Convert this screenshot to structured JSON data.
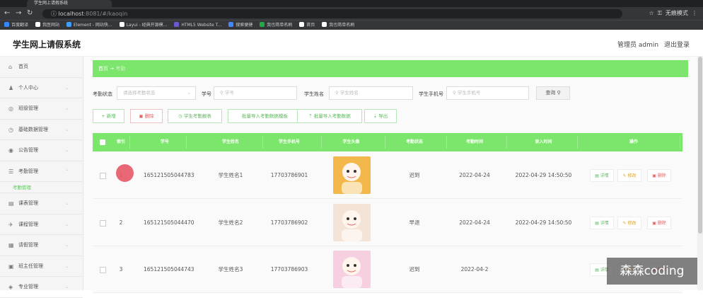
{
  "browser": {
    "tab_title": "学生网上请假系统",
    "url_host": "localhost",
    "url_rest": ":8081/#/kaoqin",
    "incognito_label": "无痕模式",
    "bookmarks": [
      {
        "label": "百度翻译",
        "color": "#3388ff"
      },
      {
        "label": "我医网站",
        "color": "#ffffff"
      },
      {
        "label": "Element - 网站快...",
        "color": "#409eff"
      },
      {
        "label": "Layui - 经典开源模...",
        "color": "#ffffff"
      },
      {
        "label": "HTML5 Website T...",
        "color": "#6a5acd"
      },
      {
        "label": "搜索便捷",
        "color": "#4488ff"
      },
      {
        "label": "我也简单名刷",
        "color": "#22aa44"
      },
      {
        "label": "首页",
        "color": "#ffffff"
      },
      {
        "label": "我也简单名刷",
        "color": "#ffffff"
      }
    ]
  },
  "header": {
    "title": "学生网上请假系统",
    "admin": "管理员 admin",
    "logout": "退出登录"
  },
  "sidebar": {
    "items": [
      {
        "label": "首页",
        "icon": "home-icon",
        "glyph": "⌂"
      },
      {
        "label": "个人中心",
        "icon": "user-icon",
        "glyph": "♟"
      },
      {
        "label": "班级管理",
        "icon": "class-icon",
        "glyph": "◎"
      },
      {
        "label": "基础数据管理",
        "icon": "data-icon",
        "glyph": "◷"
      },
      {
        "label": "公告管理",
        "icon": "notice-icon",
        "glyph": "◉"
      },
      {
        "label": "考勤管理",
        "icon": "attendance-icon",
        "glyph": "☰"
      },
      {
        "label": "课表管理",
        "icon": "schedule-icon",
        "glyph": "▤"
      },
      {
        "label": "课程管理",
        "icon": "course-icon",
        "glyph": "✈"
      },
      {
        "label": "请假管理",
        "icon": "leave-icon",
        "glyph": "▦"
      },
      {
        "label": "班主任管理",
        "icon": "teacher-icon",
        "glyph": "▣"
      },
      {
        "label": "专业管理",
        "icon": "major-icon",
        "glyph": "◈"
      }
    ],
    "sub_item": "考勤管理"
  },
  "breadcrumb": {
    "home": "首页",
    "arrow": "→",
    "current": "考勤"
  },
  "filters": {
    "status_label": "考勤状态",
    "status_placeholder": "请选择考勤状态",
    "student_no_label": "学号",
    "student_no_placeholder": "学号",
    "name_label": "学生姓名",
    "name_placeholder": "学生姓名",
    "phone_label": "学生手机号",
    "phone_placeholder": "学生手机号",
    "search_label": "查询"
  },
  "actions": {
    "add": "+ 新增",
    "delete": "删除",
    "report": "学生考勤报表",
    "import_template": "批量导入考勤数据模板",
    "import_data": "批量导入考勤数据",
    "export": "导出"
  },
  "table": {
    "headers": [
      "索引",
      "学号",
      "学生姓名",
      "学生手机号",
      "学生头像",
      "考勤状态",
      "考勤时间",
      "录入时间",
      "操作"
    ],
    "rows": [
      {
        "index": "1",
        "student_no": "165121505044783",
        "name": "学生姓名1",
        "phone": "17703786901",
        "status": "迟到",
        "date": "2022-04-24",
        "created": "2022-04-29 14:50:50",
        "avatar_color": "#f2b84b"
      },
      {
        "index": "2",
        "student_no": "165121505044470",
        "name": "学生姓名2",
        "phone": "17703786902",
        "status": "早退",
        "date": "2022-04-24",
        "created": "2022-04-29 14:50:50",
        "avatar_color": "#f4e3d7"
      },
      {
        "index": "3",
        "student_no": "165121505044743",
        "name": "学生姓名3",
        "phone": "17703786903",
        "status": "迟到",
        "date": "2022-04-2",
        "created": "",
        "avatar_color": "#f6cfe0"
      }
    ],
    "op_detail": "详情",
    "op_edit": "修改",
    "op_delete": "删除"
  },
  "watermark": "森森coding"
}
